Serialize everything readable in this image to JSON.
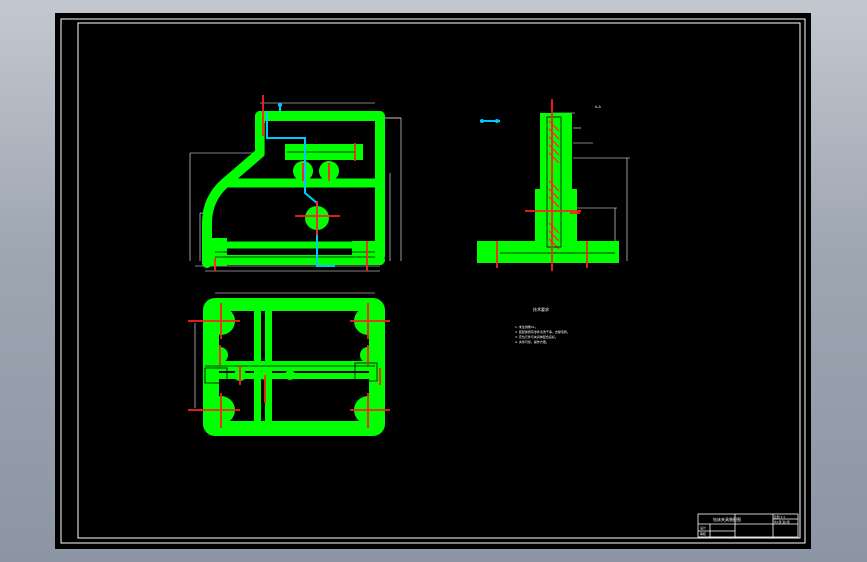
{
  "colors": {
    "background": "#000000",
    "outer_frame": "#9aa2ae",
    "border": "#ffffff",
    "part": "#00ff00",
    "centerline": "#ff2020",
    "dimension": "#ffffff",
    "hidden_path": "#00c8ff",
    "section_hatch": "#ff3040"
  },
  "drawing": {
    "views": [
      "front-view",
      "side-view",
      "top-view"
    ],
    "side_view_note": "A-A",
    "technical_requirements": {
      "title": "技术要求",
      "lines": [
        "1. 未注倒角C1。",
        "2. 装配前所有零件清洗干净，去除毛刺。",
        "3. 定位元件与夹具体配合良好。",
        "4. 夹紧可靠，操作方便。"
      ]
    },
    "title_block": {
      "drawing_name": "钻床夹具装配图",
      "scale_label": "比例 1:1",
      "sheet_label": "共1张 第1张",
      "designer_label": "设计",
      "reviewer_label": "审核"
    }
  }
}
